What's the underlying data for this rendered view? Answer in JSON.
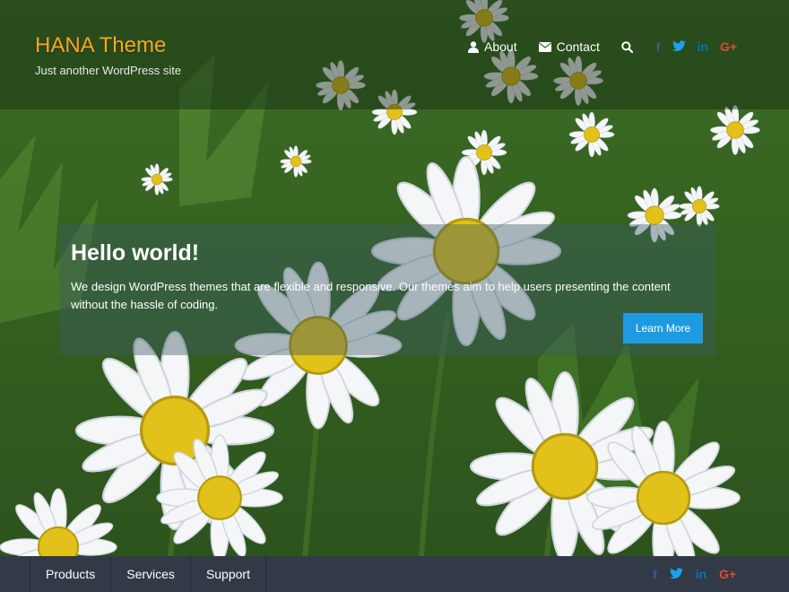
{
  "site": {
    "title": "HANA Theme",
    "description": "Just another WordPress site"
  },
  "header_nav": [
    {
      "label": "About",
      "icon": "user-icon"
    },
    {
      "label": "Contact",
      "icon": "envelope-icon"
    }
  ],
  "social": {
    "facebook": "f",
    "twitter": "t",
    "linkedin": "in",
    "googleplus": "G+"
  },
  "hero": {
    "title": "Hello world!",
    "text": "We design WordPress themes that are flexible and responsive. Our themes aim to help users presenting the content without the hassle of coding.",
    "button": "Learn More"
  },
  "footer_menu": [
    "Products",
    "Services",
    "Support"
  ],
  "colors": {
    "title": "#f5a623",
    "button": "#1e9be0",
    "footer": "#323a47",
    "facebook": "#3b5998",
    "twitter": "#1da1f2",
    "linkedin": "#0077b5",
    "googleplus": "#dd4b39"
  }
}
